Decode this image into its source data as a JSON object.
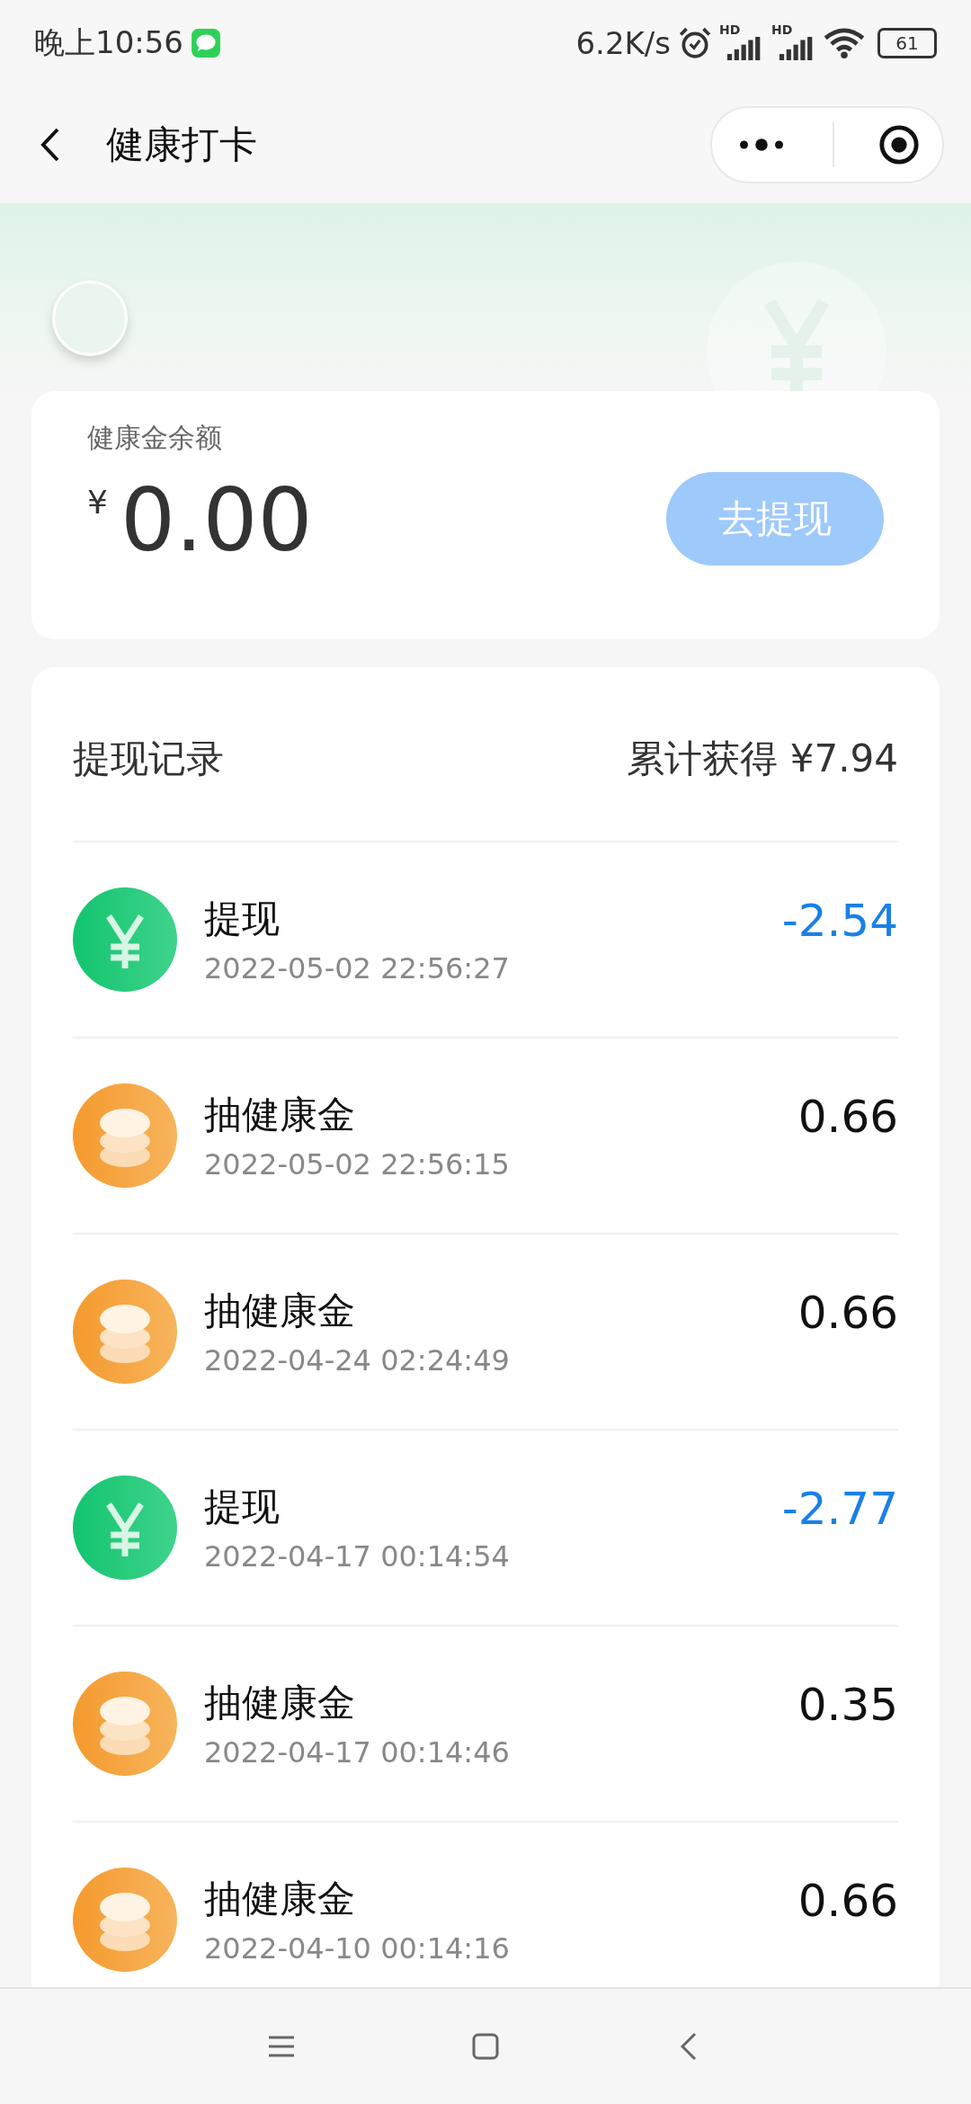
{
  "status_bar": {
    "time": "晚上10:56",
    "speed": "6.2K/s",
    "signals": [
      {
        "label": "HD"
      },
      {
        "label": "HD"
      }
    ],
    "battery": "61"
  },
  "header": {
    "title": "健康打卡"
  },
  "balance": {
    "label": "健康金余额",
    "currency": "¥",
    "amount": "0.00",
    "button": "去提现"
  },
  "records": {
    "title": "提现记录",
    "total": "累计获得 ¥7.94",
    "items": [
      {
        "kind": "withdrawal",
        "title": "提现",
        "time": "2022-05-02 22:56:27",
        "amount": "-2.54"
      },
      {
        "kind": "draw",
        "title": "抽健康金",
        "time": "2022-05-02 22:56:15",
        "amount": "0.66"
      },
      {
        "kind": "draw",
        "title": "抽健康金",
        "time": "2022-04-24 02:24:49",
        "amount": "0.66"
      },
      {
        "kind": "withdrawal",
        "title": "提现",
        "time": "2022-04-17 00:14:54",
        "amount": "-2.77"
      },
      {
        "kind": "draw",
        "title": "抽健康金",
        "time": "2022-04-17 00:14:46",
        "amount": "0.35"
      },
      {
        "kind": "draw",
        "title": "抽健康金",
        "time": "2022-04-10 00:14:16",
        "amount": "0.66"
      }
    ]
  }
}
